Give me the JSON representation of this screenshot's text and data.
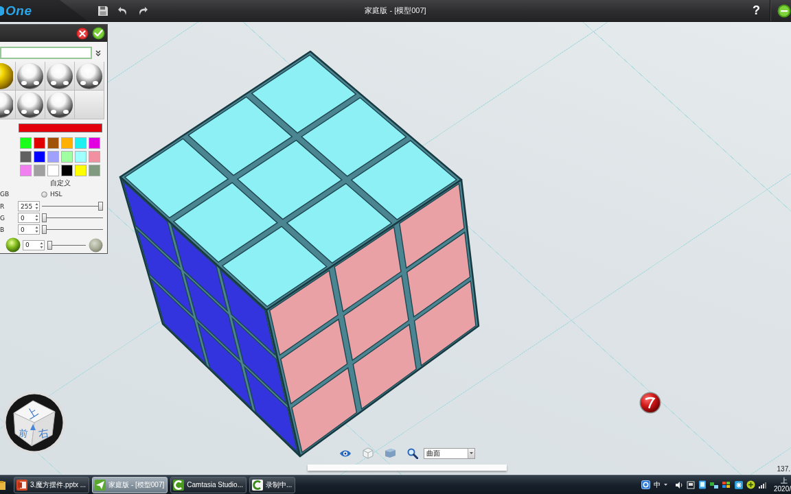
{
  "top_bar": {
    "logo": "One",
    "title": "家庭版 - [模型007]",
    "help": "?"
  },
  "color_panel": {
    "materials": [
      {
        "kind": "gold"
      },
      {
        "kind": "chrome"
      },
      {
        "kind": "chrome"
      },
      {
        "kind": "chrome"
      },
      {
        "kind": "chrome"
      },
      {
        "kind": "chrome"
      },
      {
        "kind": "chrome"
      },
      {
        "kind": "empty"
      }
    ],
    "color_preview": {
      "color": "#e3000b"
    },
    "swatches": [
      {
        "color": "#1aff1a"
      },
      {
        "color": "#e00000"
      },
      {
        "color": "#a0520a"
      },
      {
        "color": "#ffb000"
      },
      {
        "color": "#1ef0f0"
      },
      {
        "color": "#e000e0"
      },
      {
        "color": "#606060"
      },
      {
        "color": "#0000ff"
      },
      {
        "color": "#a0a0ff"
      },
      {
        "color": "#a0ffa0"
      },
      {
        "color": "#a0ffff"
      },
      {
        "color": "#f090a0"
      },
      {
        "color": "#f080f0"
      },
      {
        "color": "#a0a0a0"
      },
      {
        "color": "#ffffff"
      },
      {
        "color": "#000000"
      },
      {
        "color": "#ffff00"
      },
      {
        "color": "#809a80"
      }
    ],
    "custom_label": "自定义",
    "mode_label": "GB",
    "hsl_option": {
      "label": "HSL",
      "selected": false
    },
    "channels": [
      {
        "label": "R",
        "value": "255",
        "level": 1
      },
      {
        "label": "G",
        "value": "0",
        "level": 0
      },
      {
        "label": "B",
        "value": "0",
        "level": 0
      }
    ],
    "brightness": {
      "value": "0",
      "level": 0
    }
  },
  "viewport": {
    "view_cube": {
      "top": "上",
      "front": "前",
      "right": "右"
    },
    "readout": "137."
  },
  "bottom_toolbar": {
    "display_mode": {
      "value": "曲面"
    }
  },
  "taskbar": {
    "items": [
      {
        "label": "3.魔方摆件.pptx ...",
        "kind": "slides",
        "selected": false
      },
      {
        "label": "家庭版 - [模型007]",
        "kind": "plane",
        "selected": true
      },
      {
        "label": "Camtasia Studio...",
        "kind": "studio",
        "selected": false
      },
      {
        "label": "录制中...",
        "kind": "recorder",
        "selected": false
      }
    ],
    "tray": {
      "ime": "中",
      "clock": [
        "上",
        "2020/"
      ]
    }
  }
}
